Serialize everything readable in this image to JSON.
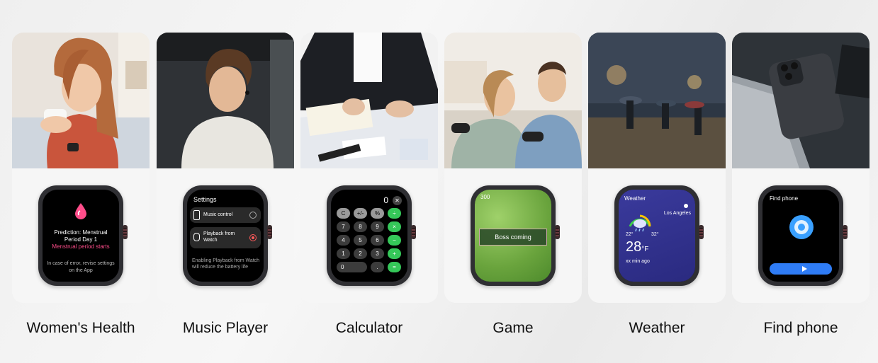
{
  "features": [
    {
      "label": "Women's Health",
      "screen": {
        "line1": "Prediction: Menstrual Period Day 1",
        "line2": "Menstrual period starts",
        "note": "In case of error, revise settings on the App"
      }
    },
    {
      "label": "Music Player",
      "screen": {
        "title": "Settings",
        "option1": "Music control",
        "option2": "Playback from Watch",
        "note": "Enabling Playback from Watch will reduce the battery life"
      }
    },
    {
      "label": "Calculator",
      "screen": {
        "display": "0",
        "clear": "✕",
        "keys": [
          "C",
          "+/-",
          "%",
          "÷",
          "7",
          "8",
          "9",
          "×",
          "4",
          "5",
          "6",
          "−",
          "1",
          "2",
          "3",
          "+",
          "0",
          ".",
          "="
        ]
      }
    },
    {
      "label": "Game",
      "screen": {
        "score": "300",
        "banner": "Boss coming"
      }
    },
    {
      "label": "Weather",
      "screen": {
        "title": "Weather",
        "city": "Los Angeles",
        "low": "22°",
        "high": "32°",
        "temp": "28",
        "unit": "°F",
        "updated": "xx min ago"
      }
    },
    {
      "label": "Find phone",
      "screen": {
        "title": "Find phone"
      }
    }
  ],
  "colors": {
    "accent_pink": "#ff4d8a",
    "calc_green": "#35c759",
    "weather_bg": "#2a2a80",
    "findphone_blue": "#2f7cf5"
  }
}
